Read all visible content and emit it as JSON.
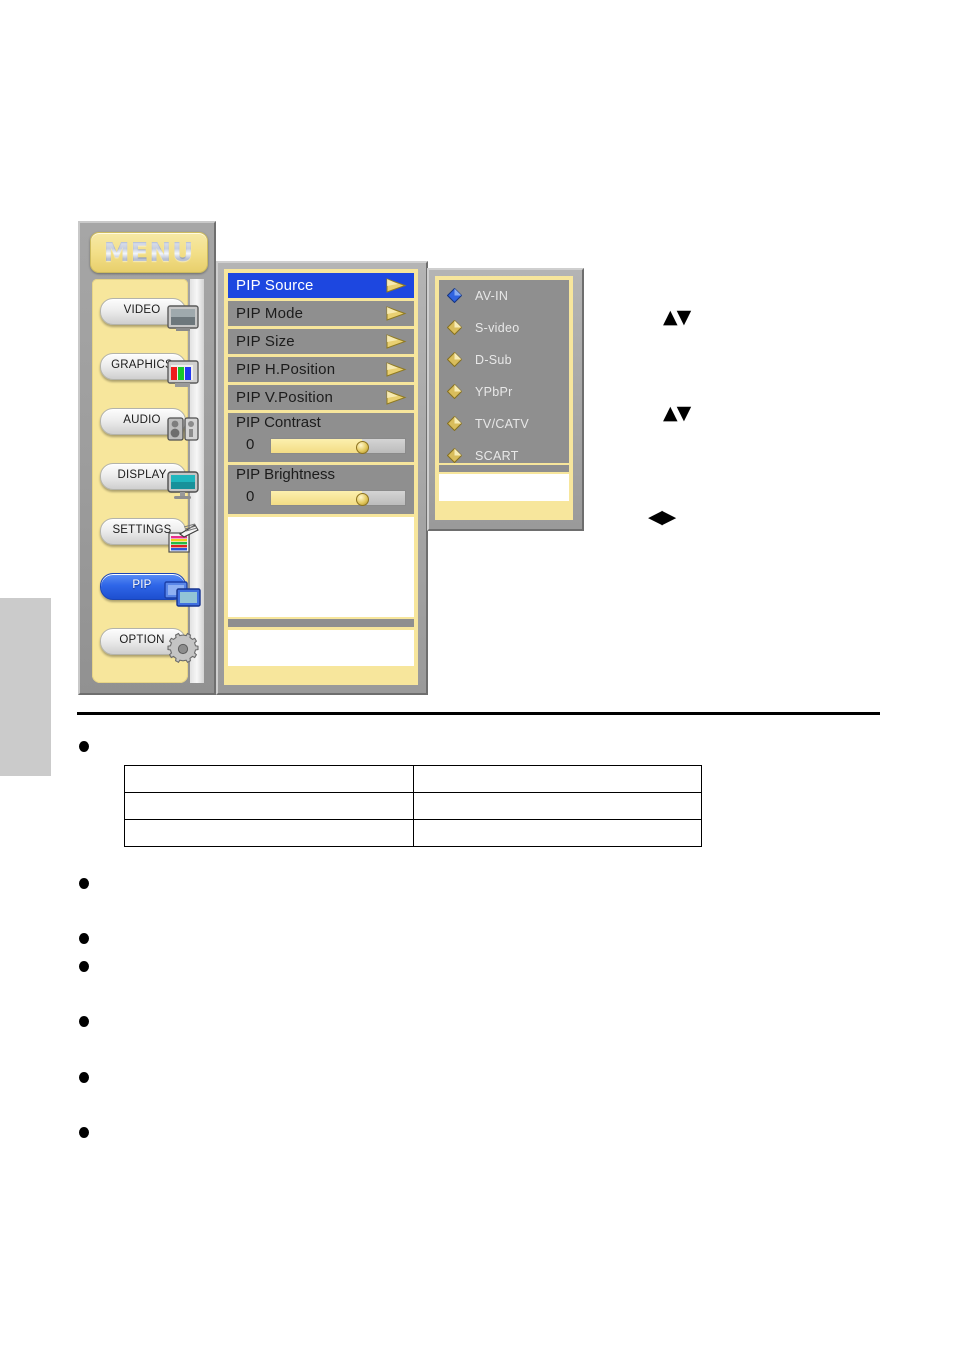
{
  "osd": {
    "banner_label": "MENU",
    "categories": [
      {
        "label": "VIDEO",
        "icon": "video-monitor-icon",
        "selected": false
      },
      {
        "label": "GRAPHICS",
        "icon": "graphics-rgb-icon",
        "selected": false
      },
      {
        "label": "AUDIO",
        "icon": "audio-speakers-icon",
        "selected": false
      },
      {
        "label": "DISPLAY",
        "icon": "display-monitor-icon",
        "selected": false
      },
      {
        "label": "SETTINGS",
        "icon": "settings-hand-icon",
        "selected": false
      },
      {
        "label": "PIP",
        "icon": "pip-screens-icon",
        "selected": true
      },
      {
        "label": "OPTION",
        "icon": "option-gear-icon",
        "selected": false
      }
    ],
    "menu_rows": [
      {
        "label": "PIP Source",
        "highlighted": true,
        "arrow": "chevron-right-icon"
      },
      {
        "label": "PIP Mode",
        "highlighted": false,
        "arrow": "chevron-right-icon"
      },
      {
        "label": "PIP Size",
        "highlighted": false,
        "arrow": "chevron-right-icon"
      },
      {
        "label": "PIP H.Position",
        "highlighted": false,
        "arrow": "chevron-right-icon"
      },
      {
        "label": "PIP V.Position",
        "highlighted": false,
        "arrow": "chevron-right-icon"
      }
    ],
    "sliders": [
      {
        "label": "PIP Contrast",
        "value": "0",
        "percent": 68
      },
      {
        "label": "PIP Brightness",
        "value": "0",
        "percent": 68
      }
    ]
  },
  "submenu": {
    "items": [
      {
        "label": "AV-IN",
        "selected": true
      },
      {
        "label": "S-video",
        "selected": false
      },
      {
        "label": "D-Sub",
        "selected": false
      },
      {
        "label": "YPbPr",
        "selected": false
      },
      {
        "label": "TV/CATV",
        "selected": false
      },
      {
        "label": "SCART",
        "selected": false
      }
    ]
  },
  "hints": [
    {
      "glyph": "▲▼",
      "name": "up-down-arrows-icon"
    },
    {
      "glyph": "▲▼",
      "name": "up-down-arrows-icon"
    },
    {
      "glyph": "◀▶",
      "name": "left-right-arrows-icon"
    }
  ],
  "document": {
    "bullets": [
      "",
      "",
      "",
      "",
      "",
      ""
    ],
    "table": {
      "rows": [
        [
          "",
          ""
        ],
        [
          "",
          ""
        ],
        [
          "",
          ""
        ]
      ]
    }
  },
  "colors": {
    "highlight_blue": "#1d47e0",
    "panel_yellow": "#f7e69c",
    "panel_gray": "#8f8f8f",
    "shell_gray": "#a0a0a0",
    "page_tab_gray": "#cbcbcb"
  }
}
